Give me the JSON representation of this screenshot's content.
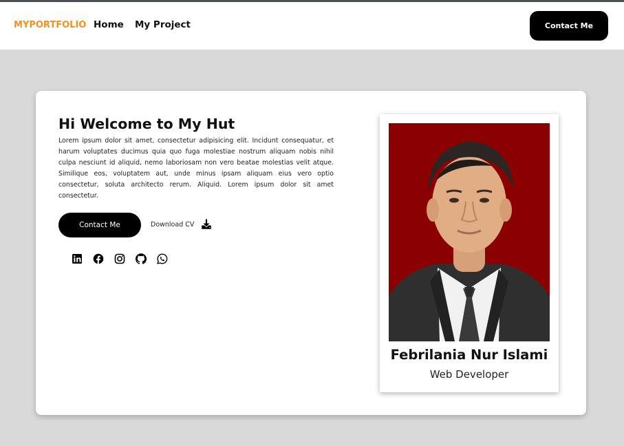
{
  "navbar": {
    "brand": "MYPORTFOLIO",
    "links": [
      "Home",
      "My Project"
    ],
    "contact_label": "Contact Me"
  },
  "hero": {
    "title": "Hi Welcome to My Hut",
    "body": "Lorem ipsum dolor sit amet, consectetur adipisicing elit. Incidunt consequatur, et harum voluptates ducimus quia quo fuga molestiae nostrum aliquam nobis nihil culpa nesciunt id aliquid, nemo laboriosam non vero beatae molestias velit atque. Similique eos, voluptatem aut, unde minus ipsam aliquam eius vero optio consectetur, soluta architecto rerum. Aliquid. Lorem ipsum dolor sit amet consectetur.",
    "contact_label": "Contact Me",
    "download_label": "Download CV",
    "download_icon": "download-icon"
  },
  "socials": [
    "linkedin-icon",
    "facebook-icon",
    "instagram-icon",
    "github-icon",
    "whatsapp-icon"
  ],
  "profile": {
    "name": "Febrilania Nur Islami",
    "role": "Web Developer"
  },
  "colors": {
    "brand": "#f4901e",
    "page_background": "#d9d9d9",
    "button": "#000000",
    "photo_background": "#8b0000"
  }
}
